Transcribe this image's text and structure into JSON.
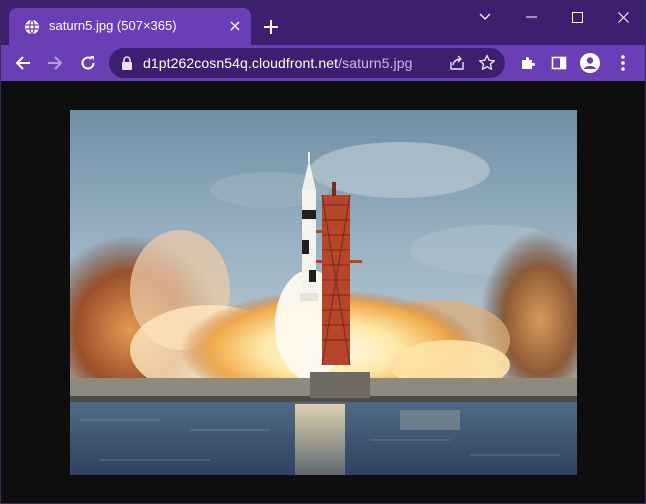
{
  "window": {
    "tab": {
      "title": "saturn5.jpg (507×365)",
      "favicon": "globe-icon"
    },
    "controls": [
      "tab-search-chevron-icon",
      "minimize-icon",
      "maximize-icon",
      "close-icon"
    ]
  },
  "toolbar": {
    "url_host": "d1pt262cosn54q.cloudfront.net",
    "url_path": "/saturn5.jpg",
    "icons": [
      "back-arrow-icon",
      "forward-arrow-icon",
      "reload-icon",
      "lock-icon",
      "share-icon",
      "star-icon",
      "puzzle-icon",
      "side-panel-icon",
      "profile-icon",
      "kebab-menu-icon"
    ]
  },
  "image": {
    "alt": "Saturn V rocket launch",
    "width": 507,
    "height": 365
  },
  "colors": {
    "titlebar": "#3c1f6e",
    "toolbar": "#6a3fb5",
    "omnibox": "#3c1f6e",
    "content_bg": "#0e0e0e"
  }
}
